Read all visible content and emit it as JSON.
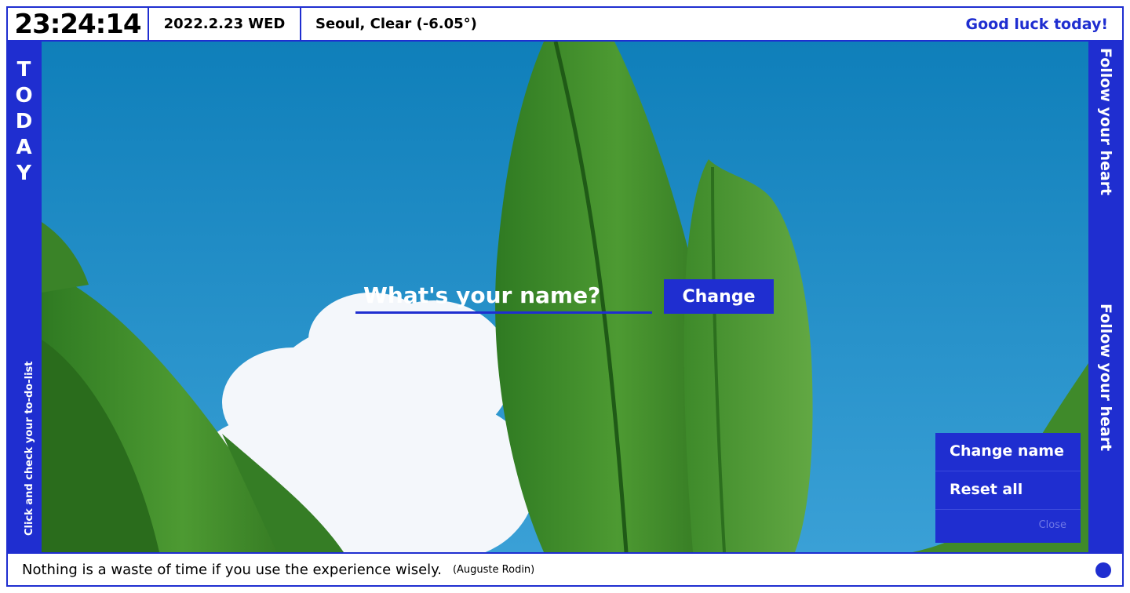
{
  "header": {
    "clock": "23:24:14",
    "date": "2022.2.23 WED",
    "weather": "Seoul, Clear (-6.05°)",
    "greeting": "Good luck today!"
  },
  "left_sidebar": {
    "title_letters": [
      "T",
      "O",
      "D",
      "A",
      "Y"
    ],
    "todo_link": "Click and check your to-do-list"
  },
  "right_sidebar": {
    "motto_1": "Follow your heart",
    "motto_2": "Follow your heart"
  },
  "name_form": {
    "placeholder": "What's your name?",
    "submit_label": "Change"
  },
  "menu": {
    "items": [
      {
        "label": "Change name"
      },
      {
        "label": "Reset all"
      }
    ],
    "close_label": "Close"
  },
  "footer": {
    "quote": "Nothing is a waste of time if you use the experience wisely.",
    "author": "(Auguste Rodin)"
  },
  "colors": {
    "accent": "#1f2ed0",
    "sky": "#1e86c0",
    "leaf": "#3f8a2a"
  }
}
